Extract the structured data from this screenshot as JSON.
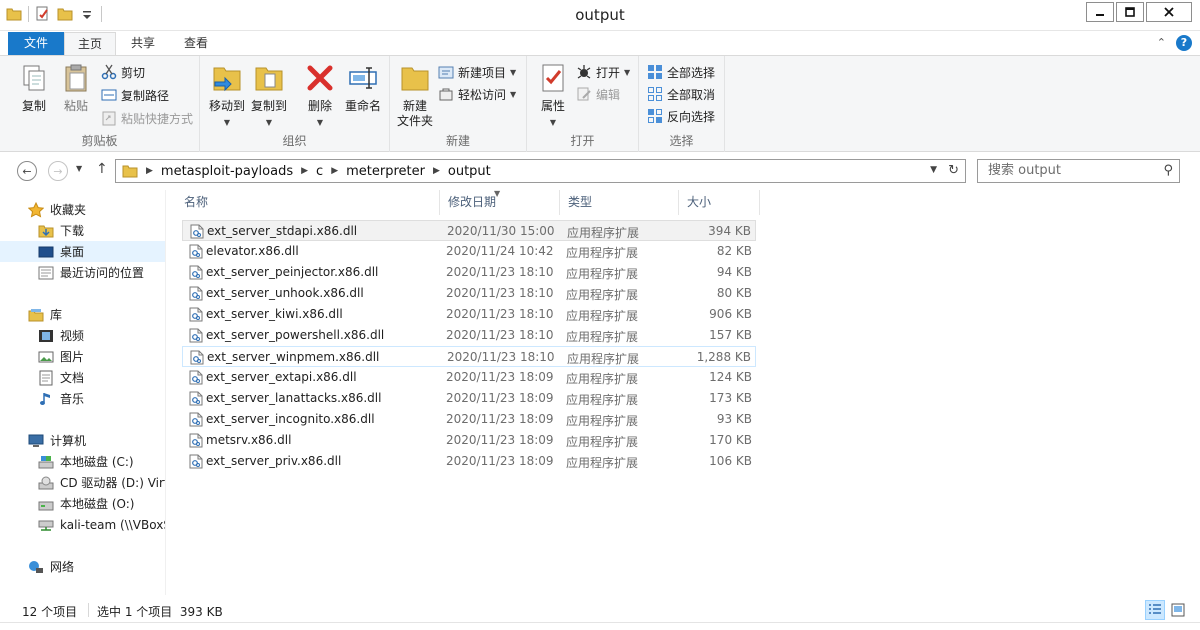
{
  "window": {
    "title": "output"
  },
  "ribbon_tabs": {
    "file": "文件",
    "home": "主页",
    "share": "共享",
    "view": "查看"
  },
  "ribbon": {
    "clipboard": {
      "label": "剪贴板",
      "copy": "复制",
      "paste": "粘贴",
      "cut": "剪切",
      "copy_path": "复制路径",
      "paste_shortcut": "粘贴快捷方式"
    },
    "organize": {
      "label": "组织",
      "move_to": "移动到",
      "copy_to": "复制到",
      "delete": "删除",
      "rename": "重命名"
    },
    "new": {
      "label": "新建",
      "new_folder_line1": "新建",
      "new_folder_line2": "文件夹",
      "new_item": "新建项目",
      "easy_access": "轻松访问"
    },
    "open": {
      "label": "打开",
      "properties": "属性",
      "open": "打开",
      "edit": "编辑"
    },
    "select": {
      "label": "选择",
      "select_all": "全部选择",
      "select_none": "全部取消",
      "invert": "反向选择"
    }
  },
  "address": {
    "crumbs": [
      "metasploit-payloads",
      "c",
      "meterpreter",
      "output"
    ],
    "search_placeholder": "搜索 output"
  },
  "sidebar": {
    "favorites": "收藏夹",
    "downloads": "下载",
    "desktop": "桌面",
    "recent": "最近访问的位置",
    "libraries": "库",
    "videos": "视频",
    "pictures": "图片",
    "documents": "文档",
    "music": "音乐",
    "computer": "计算机",
    "drive_c": "本地磁盘 (C:)",
    "drive_d": "CD 驱动器 (D:) Virt",
    "drive_o": "本地磁盘 (O:)",
    "net_share": "kali-team (\\\\VBoxS",
    "network": "网络"
  },
  "columns": {
    "name": "名称",
    "date": "修改日期",
    "type": "类型",
    "size": "大小"
  },
  "files": [
    {
      "name": "ext_server_stdapi.x86.dll",
      "date": "2020/11/30 15:00",
      "type": "应用程序扩展",
      "size": "394 KB"
    },
    {
      "name": "elevator.x86.dll",
      "date": "2020/11/24 10:42",
      "type": "应用程序扩展",
      "size": "82 KB"
    },
    {
      "name": "ext_server_peinjector.x86.dll",
      "date": "2020/11/23 18:10",
      "type": "应用程序扩展",
      "size": "94 KB"
    },
    {
      "name": "ext_server_unhook.x86.dll",
      "date": "2020/11/23 18:10",
      "type": "应用程序扩展",
      "size": "80 KB"
    },
    {
      "name": "ext_server_kiwi.x86.dll",
      "date": "2020/11/23 18:10",
      "type": "应用程序扩展",
      "size": "906 KB"
    },
    {
      "name": "ext_server_powershell.x86.dll",
      "date": "2020/11/23 18:10",
      "type": "应用程序扩展",
      "size": "157 KB"
    },
    {
      "name": "ext_server_winpmem.x86.dll",
      "date": "2020/11/23 18:10",
      "type": "应用程序扩展",
      "size": "1,288 KB"
    },
    {
      "name": "ext_server_extapi.x86.dll",
      "date": "2020/11/23 18:09",
      "type": "应用程序扩展",
      "size": "124 KB"
    },
    {
      "name": "ext_server_lanattacks.x86.dll",
      "date": "2020/11/23 18:09",
      "type": "应用程序扩展",
      "size": "173 KB"
    },
    {
      "name": "ext_server_incognito.x86.dll",
      "date": "2020/11/23 18:09",
      "type": "应用程序扩展",
      "size": "93 KB"
    },
    {
      "name": "metsrv.x86.dll",
      "date": "2020/11/23 18:09",
      "type": "应用程序扩展",
      "size": "170 KB"
    },
    {
      "name": "ext_server_priv.x86.dll",
      "date": "2020/11/23 18:09",
      "type": "应用程序扩展",
      "size": "106 KB"
    }
  ],
  "status": {
    "item_count": "12 个项目",
    "selection": "选中 1 个项目  393 KB"
  },
  "colors": {
    "accent": "#1979ca",
    "selected_row": "#f2f2f2",
    "nav_selected": "#e5f3ff",
    "header_text": "#4c607a"
  }
}
